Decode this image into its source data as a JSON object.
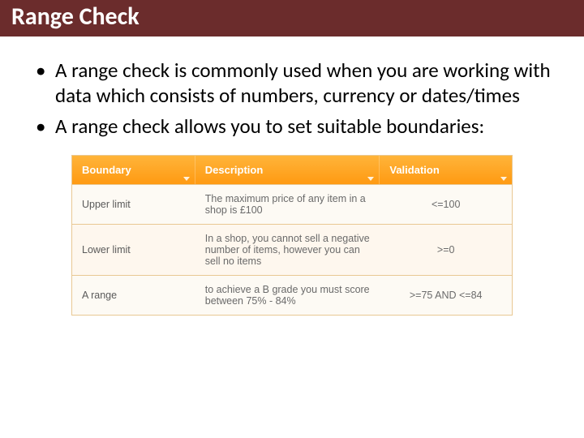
{
  "title": "Range Check",
  "bullets": [
    "A range check is commonly used when you are working with data which consists of numbers, currency or dates/times",
    "A range check allows you to set suitable boundaries:"
  ],
  "table": {
    "headers": [
      "Boundary",
      "Description",
      "Validation"
    ],
    "rows": [
      {
        "boundary": "Upper limit",
        "description": "The maximum price of any item in a shop is £100",
        "validation": "<=100"
      },
      {
        "boundary": "Lower limit",
        "description": "In a shop, you cannot sell a negative number of items, however you can sell no items",
        "validation": ">=0"
      },
      {
        "boundary": "A range",
        "description": "to achieve a B grade you must score between 75% - 84%",
        "validation": ">=75 AND <=84"
      }
    ]
  }
}
